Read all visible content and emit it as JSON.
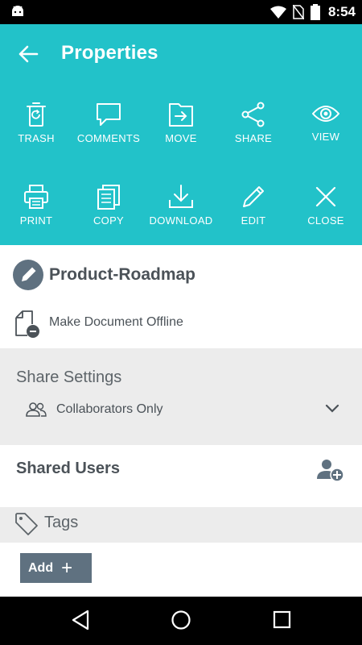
{
  "status_bar": {
    "time": "8:54",
    "icons": [
      "android-icon",
      "wifi-icon",
      "no-sim-icon",
      "battery-icon"
    ]
  },
  "header": {
    "title": "Properties",
    "background_color": "#22c2c9",
    "actions_row1": [
      {
        "label": "TRASH",
        "icon": "trash-icon"
      },
      {
        "label": "COMMENTS",
        "icon": "comments-icon"
      },
      {
        "label": "MOVE",
        "icon": "move-icon"
      },
      {
        "label": "SHARE",
        "icon": "share-icon"
      },
      {
        "label": "VIEW",
        "icon": "view-icon"
      }
    ],
    "actions_row2": [
      {
        "label": "PRINT",
        "icon": "print-icon"
      },
      {
        "label": "COPY",
        "icon": "copy-icon"
      },
      {
        "label": "DOWNLOAD",
        "icon": "download-icon"
      },
      {
        "label": "EDIT",
        "icon": "edit-icon"
      },
      {
        "label": "CLOSE",
        "icon": "close-icon"
      }
    ]
  },
  "document": {
    "name": "Product-Roadmap",
    "offline_label": "Make Document Offline"
  },
  "share_settings": {
    "title": "Share Settings",
    "selected": "Collaborators Only"
  },
  "shared_users": {
    "title": "Shared Users"
  },
  "tags": {
    "title": "Tags",
    "add_label": "Add"
  },
  "colors": {
    "accent": "#22c2c9",
    "button": "#5f7180",
    "section_gray": "#ececec"
  }
}
